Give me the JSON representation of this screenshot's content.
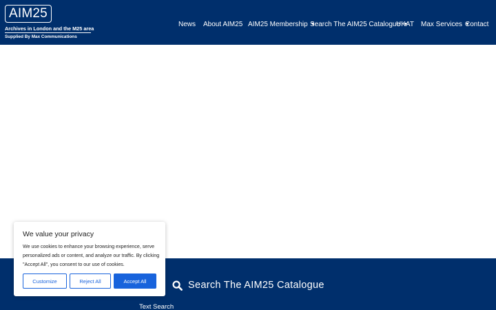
{
  "header": {
    "logo": {
      "title": "AIM25",
      "subtitle": "Archives in London and the M25 area",
      "supplied_by": "Supplied By Max Communications"
    },
    "nav": [
      {
        "label": "News"
      },
      {
        "label": "About AIM25"
      },
      {
        "label": "AIM25 Membership",
        "has_dropdown": true
      },
      {
        "label": "Search The AIM25 Catalogue",
        "has_dropdown": true
      },
      {
        "label": "UKAT"
      },
      {
        "label": "Max Services",
        "has_dropdown": true
      },
      {
        "label": "Contact"
      }
    ],
    "caret": "▼"
  },
  "footer": {
    "search_title": "Search The AIM25 Catalogue",
    "text_search_label": "Text Search",
    "search_icon": "search-icon"
  },
  "cookie_banner": {
    "title": "We value your privacy",
    "body": "We use cookies to enhance your browsing experience, serve personalized ads or content, and analyze our traffic. By clicking \"Accept All\", you consent to our use of cookies.",
    "customize_label": "Customize",
    "reject_label": "Reject All",
    "accept_label": "Accept All"
  },
  "colors": {
    "brand_navy": "#002f6c",
    "cookie_button_blue": "#1863dc",
    "text_dark": "#212121",
    "white": "#ffffff"
  }
}
